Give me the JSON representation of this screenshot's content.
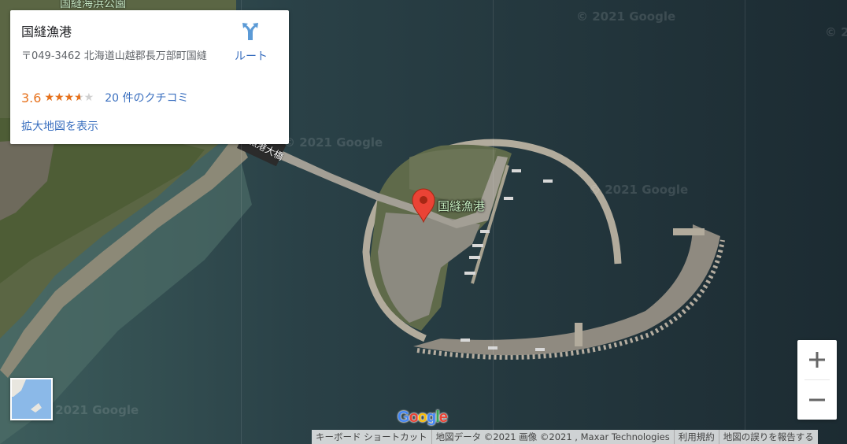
{
  "map": {
    "place_label": "国縫漁港",
    "top_label": "国縫海浜公園",
    "bridge_label": "漁港大橋",
    "watermarks": [
      "© 2021 Google",
      "© 2021 Google",
      "© 2021 Google",
      "© 2021 Google",
      "© 2021 Google",
      "© 2"
    ],
    "marker_color": "#ea4335",
    "google_logo": "Google"
  },
  "card": {
    "title": "国縫漁港",
    "address": "〒049-3462 北海道山越郡長万部町国縫",
    "rating": 3.6,
    "rating_text": "3.6",
    "reviews": "20 件のクチコミ",
    "larger_map": "拡大地図を表示",
    "directions_label": "ルート",
    "directions_icon": "directions-icon",
    "accent_color": "#3a6fbf",
    "star_color": "#e7711b"
  },
  "controls": {
    "zoom_in": "+",
    "zoom_out": "−"
  },
  "footer": {
    "shortcuts": "キーボード ショートカット",
    "map_data": "地図データ ©2021 画像 ©2021 , Maxar Technologies",
    "terms": "利用規約",
    "report": "地図の誤りを報告する"
  }
}
